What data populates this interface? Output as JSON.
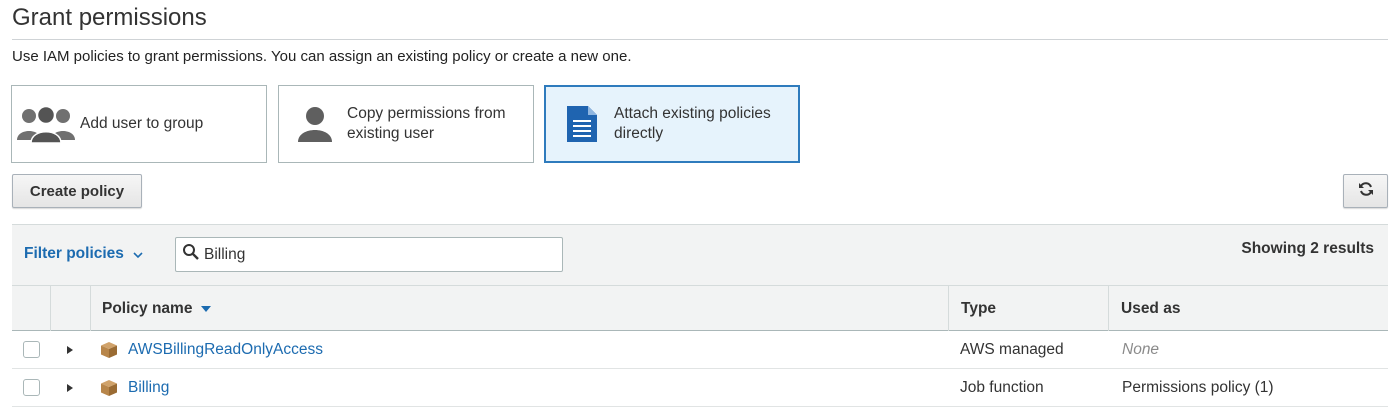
{
  "header": {
    "title": "Grant permissions",
    "subtitle": "Use IAM policies to grant permissions. You can assign an existing policy or create a new one."
  },
  "options": [
    {
      "label": "Add user to group",
      "icon": "user-group-icon",
      "selected": false
    },
    {
      "label_line1": "Copy permissions from",
      "label_line2": "existing user",
      "icon": "user-icon",
      "selected": false
    },
    {
      "label_line1": "Attach existing policies",
      "label_line2": "directly",
      "icon": "document-icon",
      "selected": true
    }
  ],
  "toolbar": {
    "create_label": "Create policy",
    "refresh_icon": "refresh-icon"
  },
  "filter": {
    "label": "Filter policies",
    "search_value": "Billing",
    "results_text": "Showing 2 results"
  },
  "table": {
    "columns": {
      "name": "Policy name",
      "type": "Type",
      "used_as": "Used as"
    },
    "rows": [
      {
        "name": "AWSBillingReadOnlyAccess",
        "type": "AWS managed",
        "used_as": "None"
      },
      {
        "name": "Billing",
        "type": "Job function",
        "used_as": "Permissions policy (1)"
      }
    ]
  },
  "colors": {
    "accent": "#1c6bb0",
    "selected_bg": "#e6f3fc",
    "selected_border": "#2e7bbd",
    "policy_icon": "#b8864a"
  }
}
